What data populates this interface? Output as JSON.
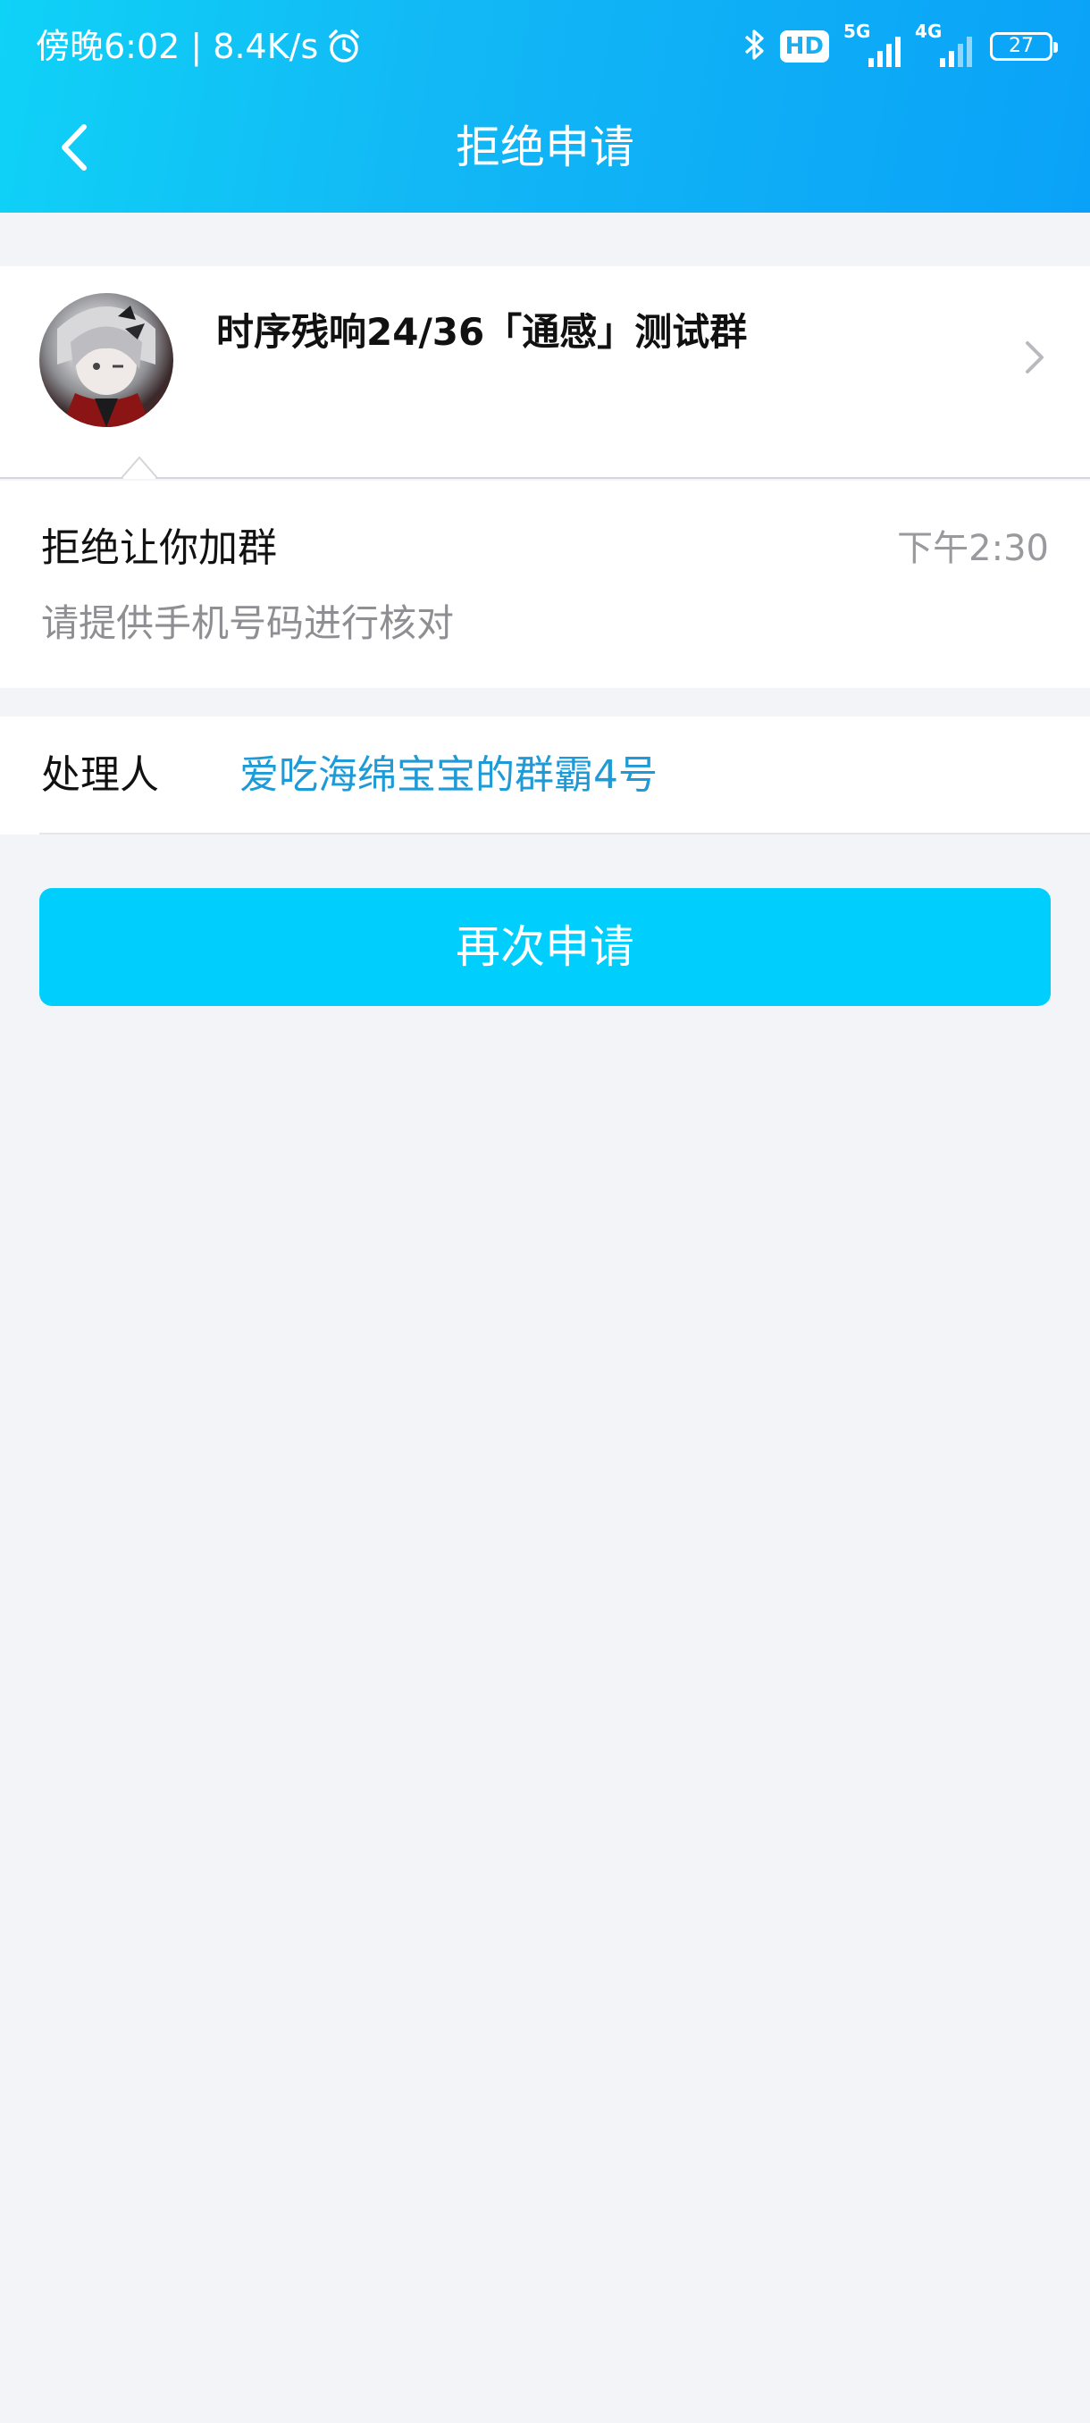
{
  "status_bar": {
    "time_speed": "傍晚6:02 | 8.4K/s",
    "alarm_icon": "alarm-clock-icon",
    "hd_label": "HD",
    "net_5g": "5G",
    "net_4g": "4G",
    "battery": "27"
  },
  "navbar": {
    "back_icon": "chevron-left-icon",
    "title": "拒绝申请"
  },
  "group": {
    "name": "时序残响24/36「通感」测试群"
  },
  "message": {
    "title": "拒绝让你加群",
    "time": "下午2:30",
    "reason": "请提供手机号码进行核对"
  },
  "handler": {
    "label": "处理人",
    "name": "爱吃海绵宝宝的群霸4号"
  },
  "actions": {
    "reapply_label": "再次申请"
  },
  "colors": {
    "header_gradient_start": "#0fd2f7",
    "header_gradient_end": "#0aa2f8",
    "button": "#00cefd",
    "link": "#1e9bd6",
    "background": "#f3f4f8"
  }
}
